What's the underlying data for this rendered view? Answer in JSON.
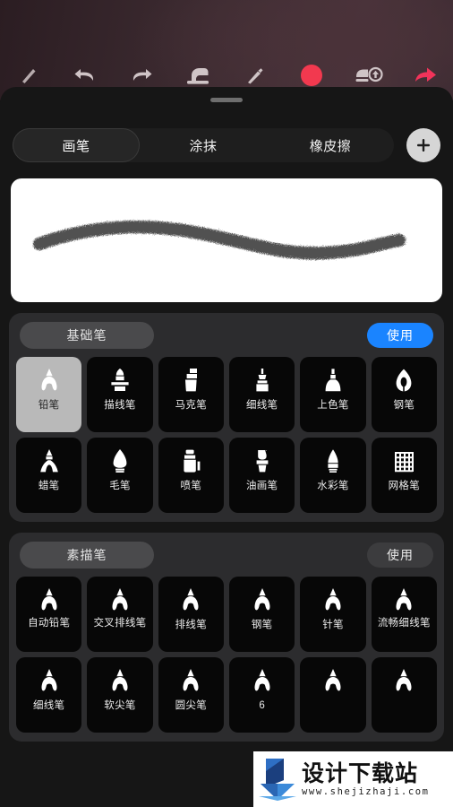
{
  "app": {
    "title": "画笔选择器"
  },
  "toolbar": {
    "items": [
      {
        "name": "brush-tool-icon",
        "label": "画笔工具"
      },
      {
        "name": "undo-icon",
        "label": "撤销"
      },
      {
        "name": "redo-icon",
        "label": "重做"
      },
      {
        "name": "eraser-icon",
        "label": "橡皮擦"
      },
      {
        "name": "pen-icon",
        "label": "钢笔"
      },
      {
        "name": "color-swatch-icon",
        "label": "颜色",
        "color": "#f2394f"
      },
      {
        "name": "layers-upload-icon",
        "label": "图层导入"
      },
      {
        "name": "share-icon",
        "label": "分享",
        "color": "#f2335a"
      }
    ]
  },
  "sheet": {
    "grabber": "拖动手柄",
    "tabs": [
      {
        "label": "画笔",
        "active": true
      },
      {
        "label": "涂抹",
        "active": false
      },
      {
        "label": "橡皮擦",
        "active": false
      }
    ],
    "add_button": {
      "icon": "plus-icon",
      "label": "+"
    }
  },
  "preview": {
    "label": "笔刷预览",
    "stroke_color": "#3a3a3a"
  },
  "sections": [
    {
      "title": "基础笔",
      "use_label": "使用",
      "use_style": "primary",
      "brushes": [
        {
          "label": "铅笔",
          "glyph": "pencil",
          "selected": true
        },
        {
          "label": "描线笔",
          "glyph": "liner",
          "selected": false
        },
        {
          "label": "马克笔",
          "glyph": "marker",
          "selected": false
        },
        {
          "label": "细线笔",
          "glyph": "fineliner",
          "selected": false
        },
        {
          "label": "上色笔",
          "glyph": "colorpen",
          "selected": false
        },
        {
          "label": "钢笔",
          "glyph": "nib",
          "selected": false
        },
        {
          "label": "蜡笔",
          "glyph": "crayon",
          "selected": false
        },
        {
          "label": "毛笔",
          "glyph": "brushpen",
          "selected": false
        },
        {
          "label": "喷笔",
          "glyph": "airbrush",
          "selected": false
        },
        {
          "label": "油画笔",
          "glyph": "oilbrush",
          "selected": false
        },
        {
          "label": "水彩笔",
          "glyph": "watercolor",
          "selected": false
        },
        {
          "label": "网格笔",
          "glyph": "grid",
          "selected": false
        }
      ]
    },
    {
      "title": "素描笔",
      "use_label": "使用",
      "use_style": "muted",
      "brushes": [
        {
          "label": "自动铅笔",
          "glyph": "pencil",
          "selected": false
        },
        {
          "label": "交叉排线笔",
          "glyph": "pencil",
          "selected": false
        },
        {
          "label": "排线笔",
          "glyph": "pencil",
          "selected": false
        },
        {
          "label": "钢笔",
          "glyph": "pencil",
          "selected": false
        },
        {
          "label": "针笔",
          "glyph": "pencil",
          "selected": false
        },
        {
          "label": "流畅细线笔",
          "glyph": "pencil",
          "selected": false
        },
        {
          "label": "细线笔",
          "glyph": "pencil",
          "selected": false
        },
        {
          "label": "软尖笔",
          "glyph": "pencil",
          "selected": false
        },
        {
          "label": "圆尖笔",
          "glyph": "pencil",
          "selected": false
        },
        {
          "label": "6",
          "glyph": "pencil",
          "selected": false
        },
        {
          "label": "",
          "glyph": "pencil",
          "selected": false
        },
        {
          "label": "",
          "glyph": "pencil",
          "selected": false
        }
      ]
    }
  ],
  "watermark": {
    "title": "设计下载站",
    "url": "www.shejizhaji.com"
  },
  "colors": {
    "accent_blue": "#1a84ff",
    "sheet_bg": "#161616",
    "section_bg": "#2c2c2e",
    "tile_bg": "#070707",
    "selected_tile_bg": "#b9b9b9"
  }
}
